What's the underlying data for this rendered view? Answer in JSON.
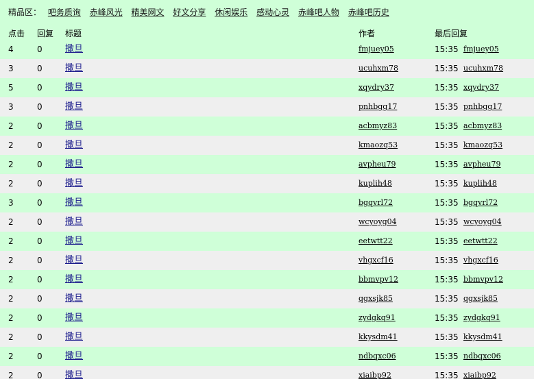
{
  "jingpin": {
    "label": "精品区：",
    "links": [
      "吧务质询",
      "赤峰风光",
      "精美网文",
      "好文分享",
      "休闲娱乐",
      "感动心灵",
      "赤峰吧人物",
      "赤峰吧历史"
    ]
  },
  "table": {
    "headers": {
      "clicks": "点击",
      "replies": "回复",
      "title": "标题",
      "author": "作者",
      "last_reply": "最后回复"
    },
    "rows": [
      {
        "clicks": "4",
        "replies": "0",
        "title": "撒旦",
        "author": "fmjuey05",
        "time": "15:35",
        "last_user": "fmjuey05"
      },
      {
        "clicks": "3",
        "replies": "0",
        "title": "撒旦",
        "author": "ucuhxm78",
        "time": "15:35",
        "last_user": "ucuhxm78"
      },
      {
        "clicks": "5",
        "replies": "0",
        "title": "撒旦",
        "author": "xqydry37",
        "time": "15:35",
        "last_user": "xqydry37"
      },
      {
        "clicks": "3",
        "replies": "0",
        "title": "撒旦",
        "author": "pnhbgg17",
        "time": "15:35",
        "last_user": "pnhbgg17"
      },
      {
        "clicks": "2",
        "replies": "0",
        "title": "撒旦",
        "author": "acbmyz83",
        "time": "15:35",
        "last_user": "acbmyz83"
      },
      {
        "clicks": "2",
        "replies": "0",
        "title": "撒旦",
        "author": "kmaozq53",
        "time": "15:35",
        "last_user": "kmaozq53"
      },
      {
        "clicks": "2",
        "replies": "0",
        "title": "撒旦",
        "author": "avpheu79",
        "time": "15:35",
        "last_user": "avpheu79"
      },
      {
        "clicks": "2",
        "replies": "0",
        "title": "撒旦",
        "author": "kuplih48",
        "time": "15:35",
        "last_user": "kuplih48"
      },
      {
        "clicks": "3",
        "replies": "0",
        "title": "撒旦",
        "author": "bgqvrl72",
        "time": "15:35",
        "last_user": "bgqvrl72"
      },
      {
        "clicks": "2",
        "replies": "0",
        "title": "撒旦",
        "author": "wcyoyg04",
        "time": "15:35",
        "last_user": "wcyoyg04"
      },
      {
        "clicks": "2",
        "replies": "0",
        "title": "撒旦",
        "author": "eetwtt22",
        "time": "15:35",
        "last_user": "eetwtt22"
      },
      {
        "clicks": "2",
        "replies": "0",
        "title": "撒旦",
        "author": "vhgxcf16",
        "time": "15:35",
        "last_user": "vhgxcf16"
      },
      {
        "clicks": "2",
        "replies": "0",
        "title": "撒旦",
        "author": "bbmvpv12",
        "time": "15:35",
        "last_user": "bbmvpv12"
      },
      {
        "clicks": "2",
        "replies": "0",
        "title": "撒旦",
        "author": "qgxsjk85",
        "time": "15:35",
        "last_user": "qgxsjk85"
      },
      {
        "clicks": "2",
        "replies": "0",
        "title": "撒旦",
        "author": "zydgkq91",
        "time": "15:35",
        "last_user": "zydgkq91"
      },
      {
        "clicks": "2",
        "replies": "0",
        "title": "撒旦",
        "author": "kkysdm41",
        "time": "15:35",
        "last_user": "kkysdm41"
      },
      {
        "clicks": "2",
        "replies": "0",
        "title": "撒旦",
        "author": "ndbqxc06",
        "time": "15:35",
        "last_user": "ndbqxc06"
      },
      {
        "clicks": "2",
        "replies": "0",
        "title": "撒旦",
        "author": "xiaibp92",
        "time": "15:35",
        "last_user": "xiaibp92"
      }
    ]
  }
}
